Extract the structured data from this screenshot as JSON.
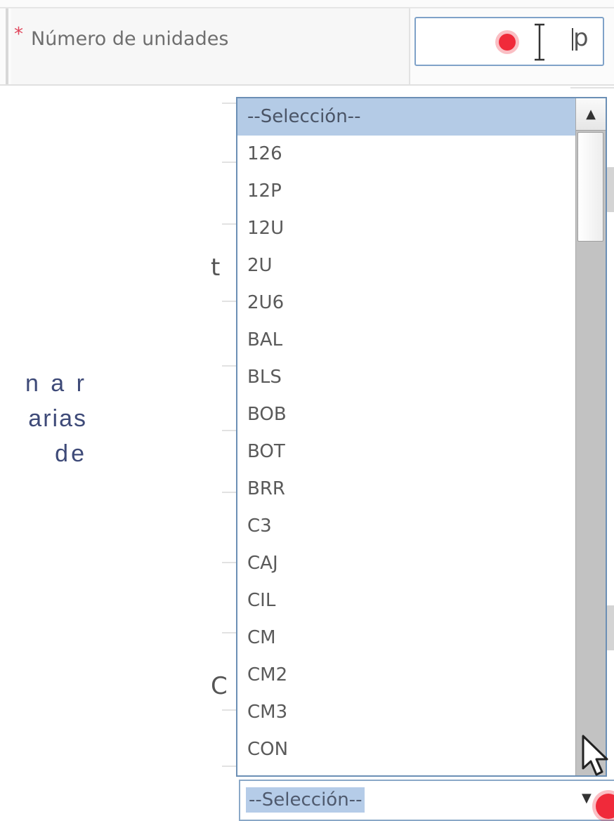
{
  "form": {
    "required_marker": "*",
    "field_label": "Número de unidades",
    "input_value": "p"
  },
  "overlay_text": {
    "line1": "n a r",
    "line2": "arias",
    "line3": "de"
  },
  "background_fragments": {
    "frag1": "t",
    "frag2": "C"
  },
  "dropdown": {
    "options": [
      "--Selección--",
      "126",
      "12P",
      "12U",
      "2U",
      "2U6",
      "BAL",
      "BLS",
      "BOB",
      "BOT",
      "BRR",
      "C3",
      "CAJ",
      "CIL",
      "CM",
      "CM2",
      "CM3",
      "CON"
    ],
    "selected_index": 0,
    "scroll_up_glyph": "▲"
  },
  "select": {
    "value": "--Selección--",
    "arrow_glyph": "▼"
  },
  "colors": {
    "required_star": "#e0445a",
    "highlight": "#b4cbe6",
    "focus_border": "#7fa2c8",
    "record_indicator": "#f02a3a",
    "overlay_text": "#3e4a78"
  },
  "icons": {
    "recording": "record-indicator-icon",
    "text_cursor": "ibeam-cursor-icon",
    "mouse": "mouse-pointer-icon"
  }
}
